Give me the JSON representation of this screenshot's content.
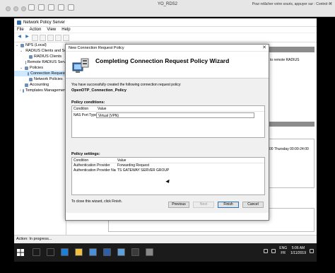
{
  "vm": {
    "title": "YO_RDS2",
    "hint": "Pour relâcher votre souris, appuyer sur : Control-⌘"
  },
  "mmc": {
    "title": "Network Policy Server",
    "menu": [
      "File",
      "Action",
      "View",
      "Help"
    ],
    "tree": [
      {
        "label": "NPS (Local)",
        "indent": 0,
        "twisty": "⌄"
      },
      {
        "label": "RADIUS Clients and Serv",
        "indent": 1,
        "twisty": "⌄"
      },
      {
        "label": "RADIUS Clients",
        "indent": 2,
        "twisty": ""
      },
      {
        "label": "Remote RADIUS Serv",
        "indent": 2,
        "twisty": ""
      },
      {
        "label": "Policies",
        "indent": 1,
        "twisty": "⌄"
      },
      {
        "label": "Connection Request",
        "indent": 2,
        "twisty": "",
        "selected": true
      },
      {
        "label": "Network Policies",
        "indent": 2,
        "twisty": ""
      },
      {
        "label": "Accounting",
        "indent": 1,
        "twisty": ""
      },
      {
        "label": "Templates Managemen",
        "indent": 1,
        "twisty": "›"
      }
    ],
    "right_text": "to remote RADIUS",
    "right_date": "00 Thursday 00:00-24:00",
    "status": "Action: In progress..."
  },
  "wizard": {
    "window_title": "New Connection Request Policy",
    "close_glyph": "✕",
    "heading": "Completing Connection Request Policy Wizard",
    "success_text": "You have successfully created the following connection request policy:",
    "policy_name": "OpenOTP_Connection_Policy",
    "conditions_label": "Policy conditions:",
    "conditions_columns": [
      "Condition",
      "Value"
    ],
    "conditions": [
      {
        "condition": "NAS Port Type",
        "value": "Virtual (VPN)"
      }
    ],
    "settings_label": "Policy settings:",
    "settings_columns": [
      "Condition",
      "Value"
    ],
    "settings": [
      {
        "condition": "Authentication Provider",
        "value": "Forwarding Request"
      },
      {
        "condition": "Authentication Provider Name",
        "value": "TS GATEWAY SERVER GROUP"
      }
    ],
    "close_hint": "To close this wizard, click Finish.",
    "buttons": {
      "previous": "Previous",
      "next": "Next",
      "finish": "Finish",
      "cancel": "Cancel"
    }
  },
  "taskbar": {
    "apps": [
      {
        "name": "search-icon",
        "color": "#1b1b1b"
      },
      {
        "name": "task-view-icon",
        "color": "#1b1b1b"
      },
      {
        "name": "edge-icon",
        "color": "#1e7fd8"
      },
      {
        "name": "explorer-icon",
        "color": "#f0c040"
      },
      {
        "name": "server-manager-icon",
        "color": "#4a90d9"
      },
      {
        "name": "powershell-icon",
        "color": "#2c5fa8"
      },
      {
        "name": "nps-icon",
        "color": "#5fa0d8"
      },
      {
        "name": "cmd-icon",
        "color": "#3a3a3a"
      },
      {
        "name": "mmc-icon",
        "color": "#888888"
      }
    ],
    "lang_top": "ENG",
    "lang_bottom": "FR",
    "time": "5:06 AM",
    "date": "1/11/2019"
  },
  "colors": {
    "accent": "#2a72c0",
    "selection": "#cde8ff",
    "taskbar": "#1b1b1b"
  }
}
